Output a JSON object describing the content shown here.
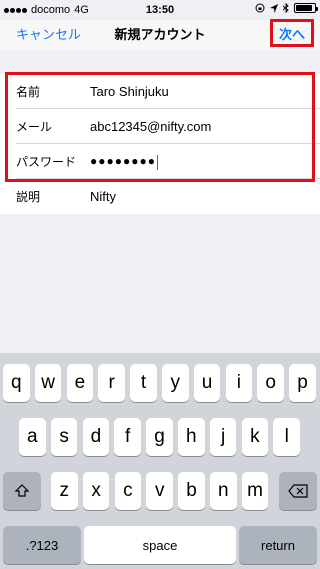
{
  "status": {
    "carrier": "docomo",
    "network": "4G",
    "time": "13:50",
    "icons": [
      "lock-rotation-icon",
      "location-icon",
      "bluetooth-icon",
      "battery-icon"
    ],
    "battery_level": 0.9
  },
  "nav": {
    "cancel": "キャンセル",
    "title": "新規アカウント",
    "next": "次へ"
  },
  "form": {
    "name_label": "名前",
    "name_value": "Taro Shinjuku",
    "mail_label": "メール",
    "mail_value": "abc12345@nifty.com",
    "password_label": "パスワード",
    "password_value": "●●●●●●●●",
    "desc_label": "説明",
    "desc_value": "Nifty"
  },
  "keyboard": {
    "row1": [
      "q",
      "w",
      "e",
      "r",
      "t",
      "y",
      "u",
      "i",
      "o",
      "p"
    ],
    "row2": [
      "a",
      "s",
      "d",
      "f",
      "g",
      "h",
      "j",
      "k",
      "l"
    ],
    "row3": [
      "z",
      "x",
      "c",
      "v",
      "b",
      "n",
      "m"
    ],
    "numbers": ".?123",
    "space": "space",
    "return": "return"
  },
  "colors": {
    "accent": "#0a7aff",
    "highlight": "#e0101a"
  }
}
